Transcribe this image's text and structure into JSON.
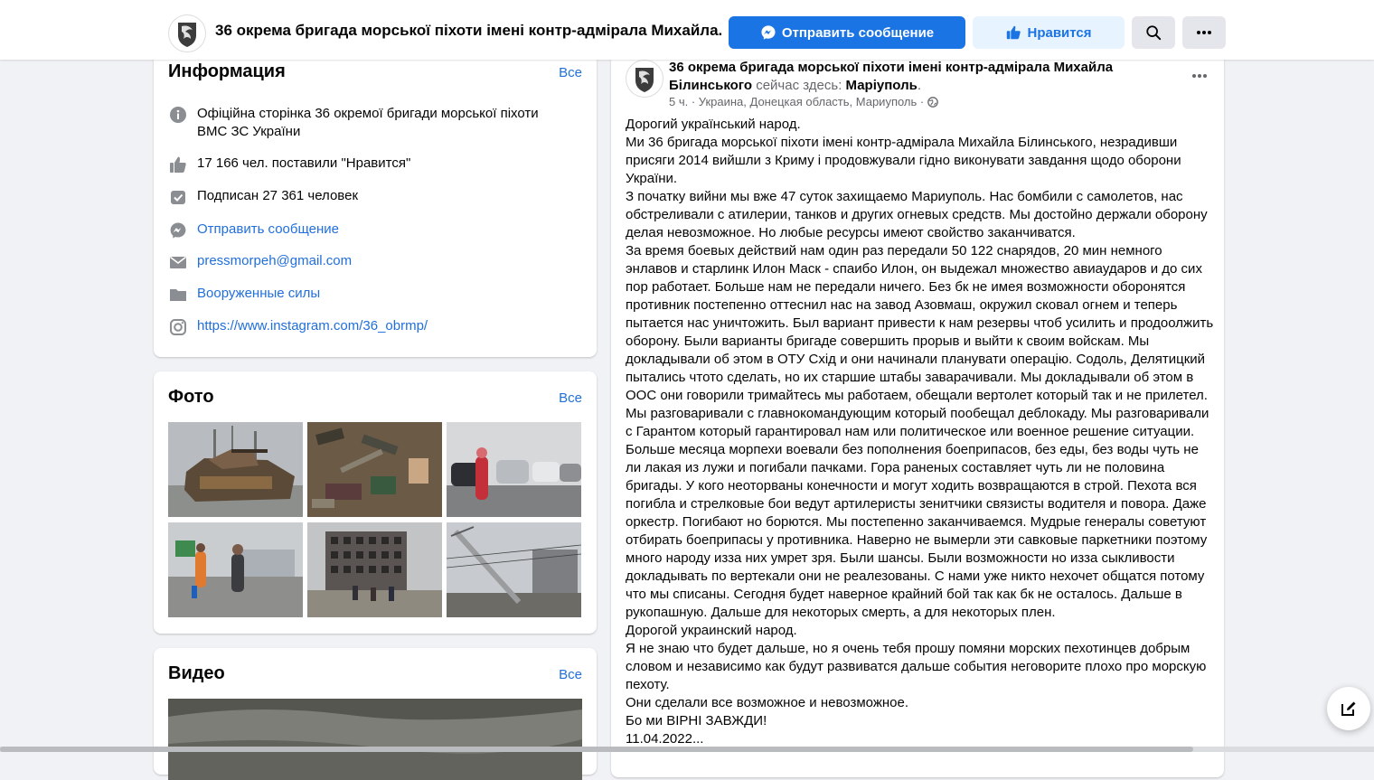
{
  "topbar": {
    "page_title": "36 окрема бригада морської піхоти імені контр-адмірала Михайла...",
    "send_message_label": "Отправить сообщение",
    "like_label": "Нравится",
    "search_icon": "search-icon",
    "more_icon": "more-icon",
    "primary_color": "#1b74e4"
  },
  "info": {
    "heading": "Информация",
    "see_all": "Все",
    "description": "Офіційна сторінка 36 окремої бригади морської піхоти ВМС ЗС України",
    "likes": "17 166 чел. поставили \"Нравится\"",
    "followers": "Подписан 27 361 человек",
    "send_message": "Отправить сообщение",
    "email": "pressmorpeh@gmail.com",
    "category": "Вооруженные силы",
    "instagram": "https://www.instagram.com/36_obrmp/"
  },
  "photos": {
    "heading": "Фото",
    "see_all": "Все"
  },
  "videos": {
    "heading": "Видео",
    "see_all": "Все"
  },
  "post": {
    "author": "36 окрема бригада морської піхоти імені контр-адмірала Михайла Білинського",
    "here_text": "сейчас здесь:",
    "place": "Маріуполь",
    "meta": "5 ч. · Украина, Донецкая область, Мариуполь ·",
    "lines": [
      "Дорогий український народ.",
      "Ми 36 бригада морської  піхоти  імені контр-адмірала  Михайла Білинського,  незрадивши присяги 2014 вийшли  з Криму  і продовжували гідно виконувати завдання щодо оборони України.",
      "З початку вийни мы вже 47 суток захищаемо Мариуполь. Нас бомбили с самолетов, нас обстреливали с атилерии, танков и других огневых средств. Мы достойно держали оборону делая невозможное. Но любые ресурсы имеют свойство заканчиватся.",
      "За время боевых действий нам один раз передали 50 122 снарядов, 20 мин немного энлавов и старлинк Илон Маск - спаибо Илон, он выдежал множество авиаударов и до сих пор работает. Больше нам не передали ничего. Без бк не имея возможности оборонятся противник постепенно оттеснил нас на завод Азовмаш, окружил сковал огнем и теперь пытается нас уничтожить. Был вариант привести к нам резервы чтоб усилить и продоолжить оборону. Были варианты бригаде совершить прорыв и выйти к своим войскам. Мы докладывали об этом в ОТУ Схід и они начинали планувати операцію. Содоль, Делятицкий пытались чтото сделать, но их старшие штабы заварачивали. Мы докладывали об этом в ООС они говорили тримайтесь мы работаем, обещали вертолет который так и не прилетел. Мы разговаривали с главнокомандующим который пообещал деблокаду. Мы разговаривали с Гарантом который гарантировал нам или политическое или военное решение ситуации. Больше месяца морпехи воевали без пополнения боеприпасов, без еды, без воды чуть не ли лакая из лужи и погибали пачками. Гора раненых составляет чуть ли не половина бригады. У кого неоторваны конечности и могут ходить возвращаются в строй. Пехота вся погибла и стрелковые бои ведут артилеристы зенитчики связисты водителя и повора. Даже оркестр. Погибают но борются. Мы постепенно заканчиваемся. Мудрые генералы советуют отбирать боеприпасы у противника. Наверно не вымерли эти савковые паркетники поэтому много народу изза них умрет зря. Были шансы. Были возможности но изза сыкливости докладывать по вертекали они не реалезованы. С нами уже никто нехочет общатся потому что мы списаны. Сегодня будет наверное крайний бой так как бк не осталось. Дальше в рукопашную. Дальше для некоторых смерть, а для некоторых плен.",
      "Дорогой украинский народ.",
      "Я не знаю что будет дальше, но я очень тебя прошу помяни морских пехотинцев добрым словом и независимо как будут развиватся дальше события неговорите плохо про морскую пехоту.",
      "Они сделали все возможное и невозможное.",
      "Бо ми ВІРНІ ЗАВЖДИ!",
      "11.04.2022..."
    ]
  }
}
